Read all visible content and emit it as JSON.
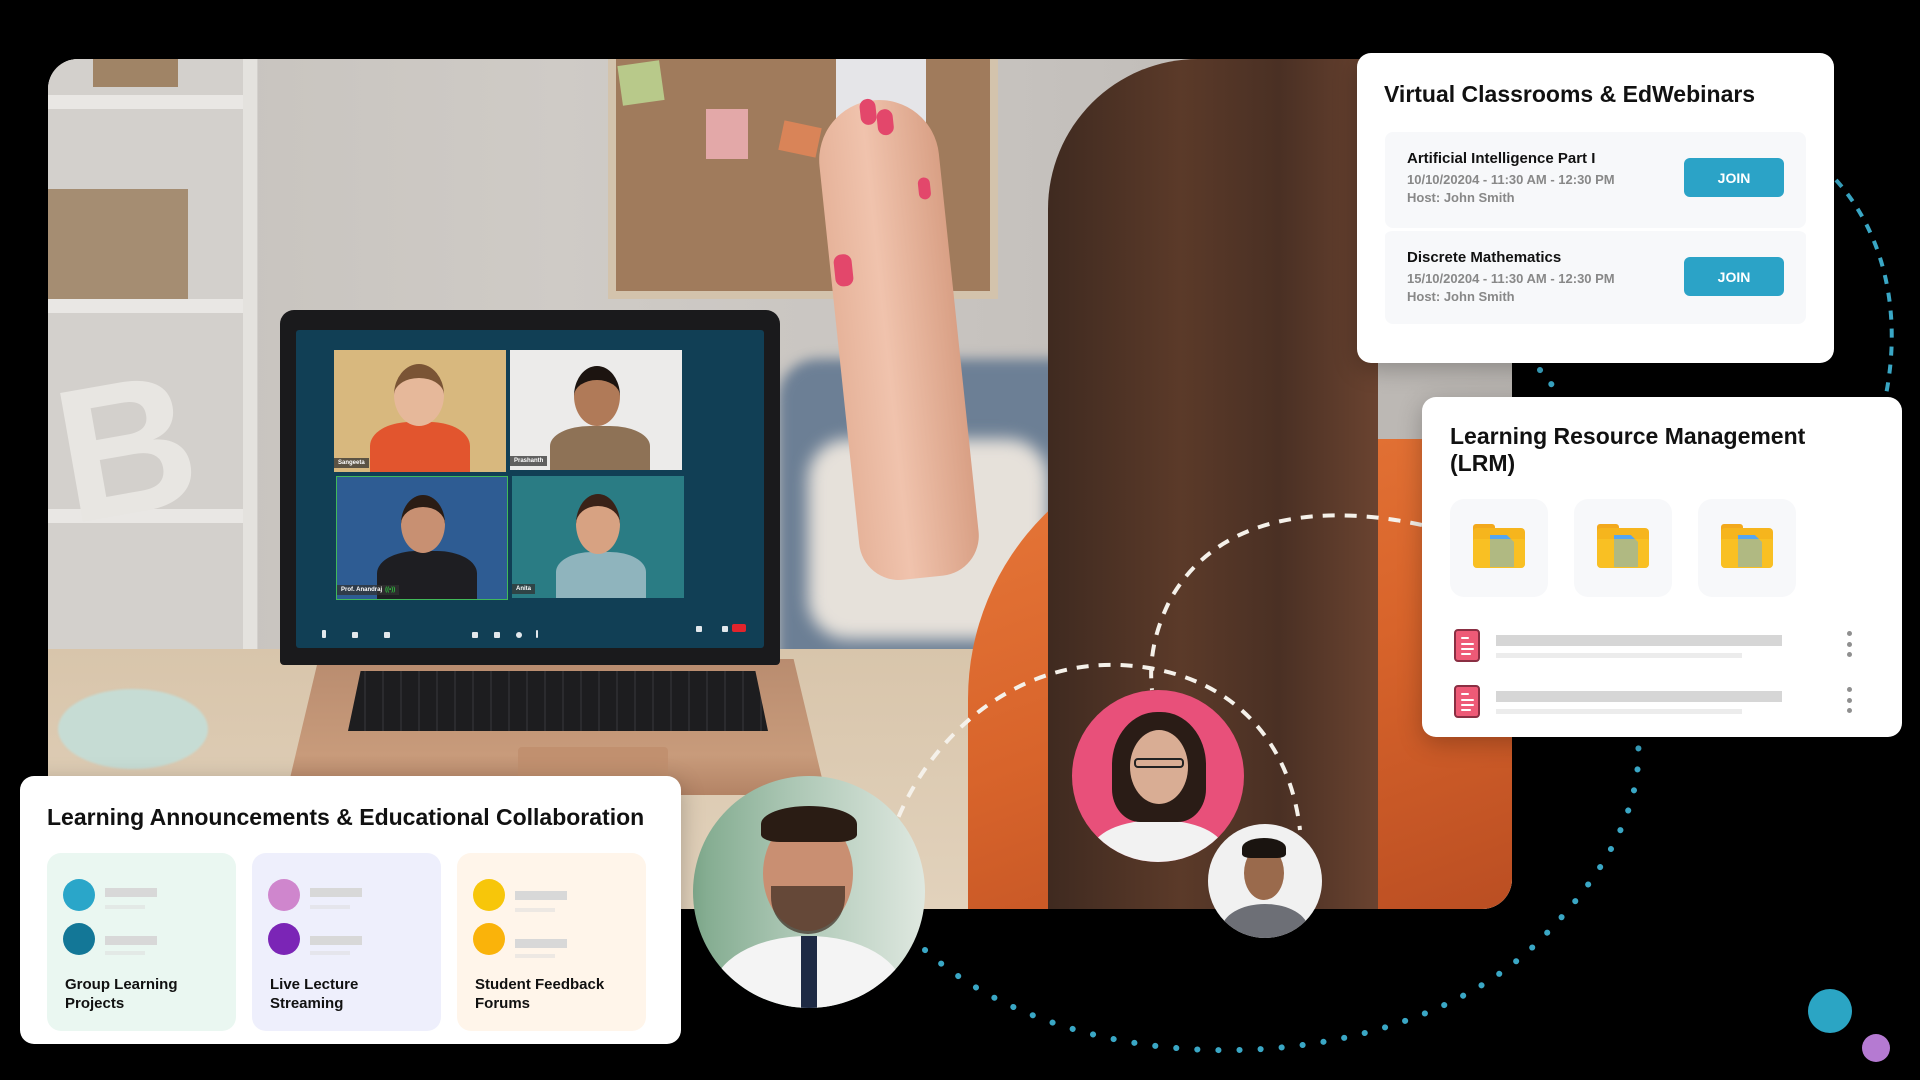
{
  "scene": {
    "description": "woman waving at laptop video call",
    "video_call": {
      "participants": [
        {
          "name": "Sangeeta",
          "speaking": false
        },
        {
          "name": "Prashanth",
          "speaking": false
        },
        {
          "name": "Prof. Anandraj",
          "speaking": true
        },
        {
          "name": "Anita",
          "speaking": false
        }
      ],
      "toolbar_icons": [
        "mic-icon",
        "camera-icon",
        "share-screen-icon",
        "grid-icon",
        "raise-hand-icon",
        "reaction-icon",
        "more-icon",
        "participants-icon",
        "chat-icon",
        "end-call-icon"
      ]
    }
  },
  "virtual_classrooms": {
    "title": "Virtual Classrooms & EdWebinars",
    "sessions": [
      {
        "name": "Artificial Intelligence Part I",
        "datetime": "10/10/20204 - 11:30 AM - 12:30 PM",
        "host": "Host: John Smith",
        "button": "JOIN"
      },
      {
        "name": "Discrete Mathematics",
        "datetime": "15/10/20204 - 11:30 AM - 12:30 PM",
        "host": "Host: John Smith",
        "button": "JOIN"
      }
    ]
  },
  "lrm": {
    "title": "Learning Resource Management (LRM)",
    "folders": [
      {
        "icon": "folder-icon"
      },
      {
        "icon": "folder-icon"
      },
      {
        "icon": "folder-icon"
      }
    ],
    "files": [
      {
        "icon": "document-icon",
        "menu_icon": "more-vertical-icon"
      },
      {
        "icon": "document-icon",
        "menu_icon": "more-vertical-icon"
      }
    ]
  },
  "announcements": {
    "title": "Learning Announcements & Educational Collaboration",
    "tiles": [
      {
        "label": "Group Learning Projects",
        "bg": "#eaf7f1",
        "dots": [
          "#2aa6c9",
          "#137797"
        ]
      },
      {
        "label": "Live Lecture Streaming",
        "bg": "#eeeffc",
        "dots": [
          "#cf86cd",
          "#7b25b6"
        ]
      },
      {
        "label": "Student Feedback Forums",
        "bg": "#fff5ea",
        "dots": [
          "#f7c60a",
          "#fab30a"
        ]
      }
    ]
  },
  "colors": {
    "accent": "#2ba3c7",
    "background": "#000000",
    "dotted_path": "#3aa7c5",
    "deco_circle_teal": "#2ba5c4",
    "deco_circle_purple": "#b57ad2"
  }
}
